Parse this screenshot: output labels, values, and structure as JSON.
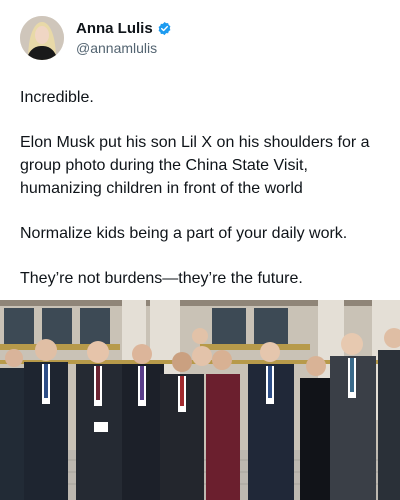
{
  "author": {
    "display_name": "Anna Lulis",
    "handle": "@annamlulis",
    "verified": true,
    "avatar_icon": "avatar-photo"
  },
  "tweet": {
    "paragraphs": [
      "Incredible.",
      "Elon Musk put his son Lil X on his shoulders for a group photo during the China State Visit, humanizing children in front of the world",
      "Normalize kids being a part of your daily work.",
      "They’re not burdens—they’re the future."
    ]
  },
  "colors": {
    "verified": "#1d9bf0",
    "handle": "#536471",
    "text": "#0f1419"
  }
}
